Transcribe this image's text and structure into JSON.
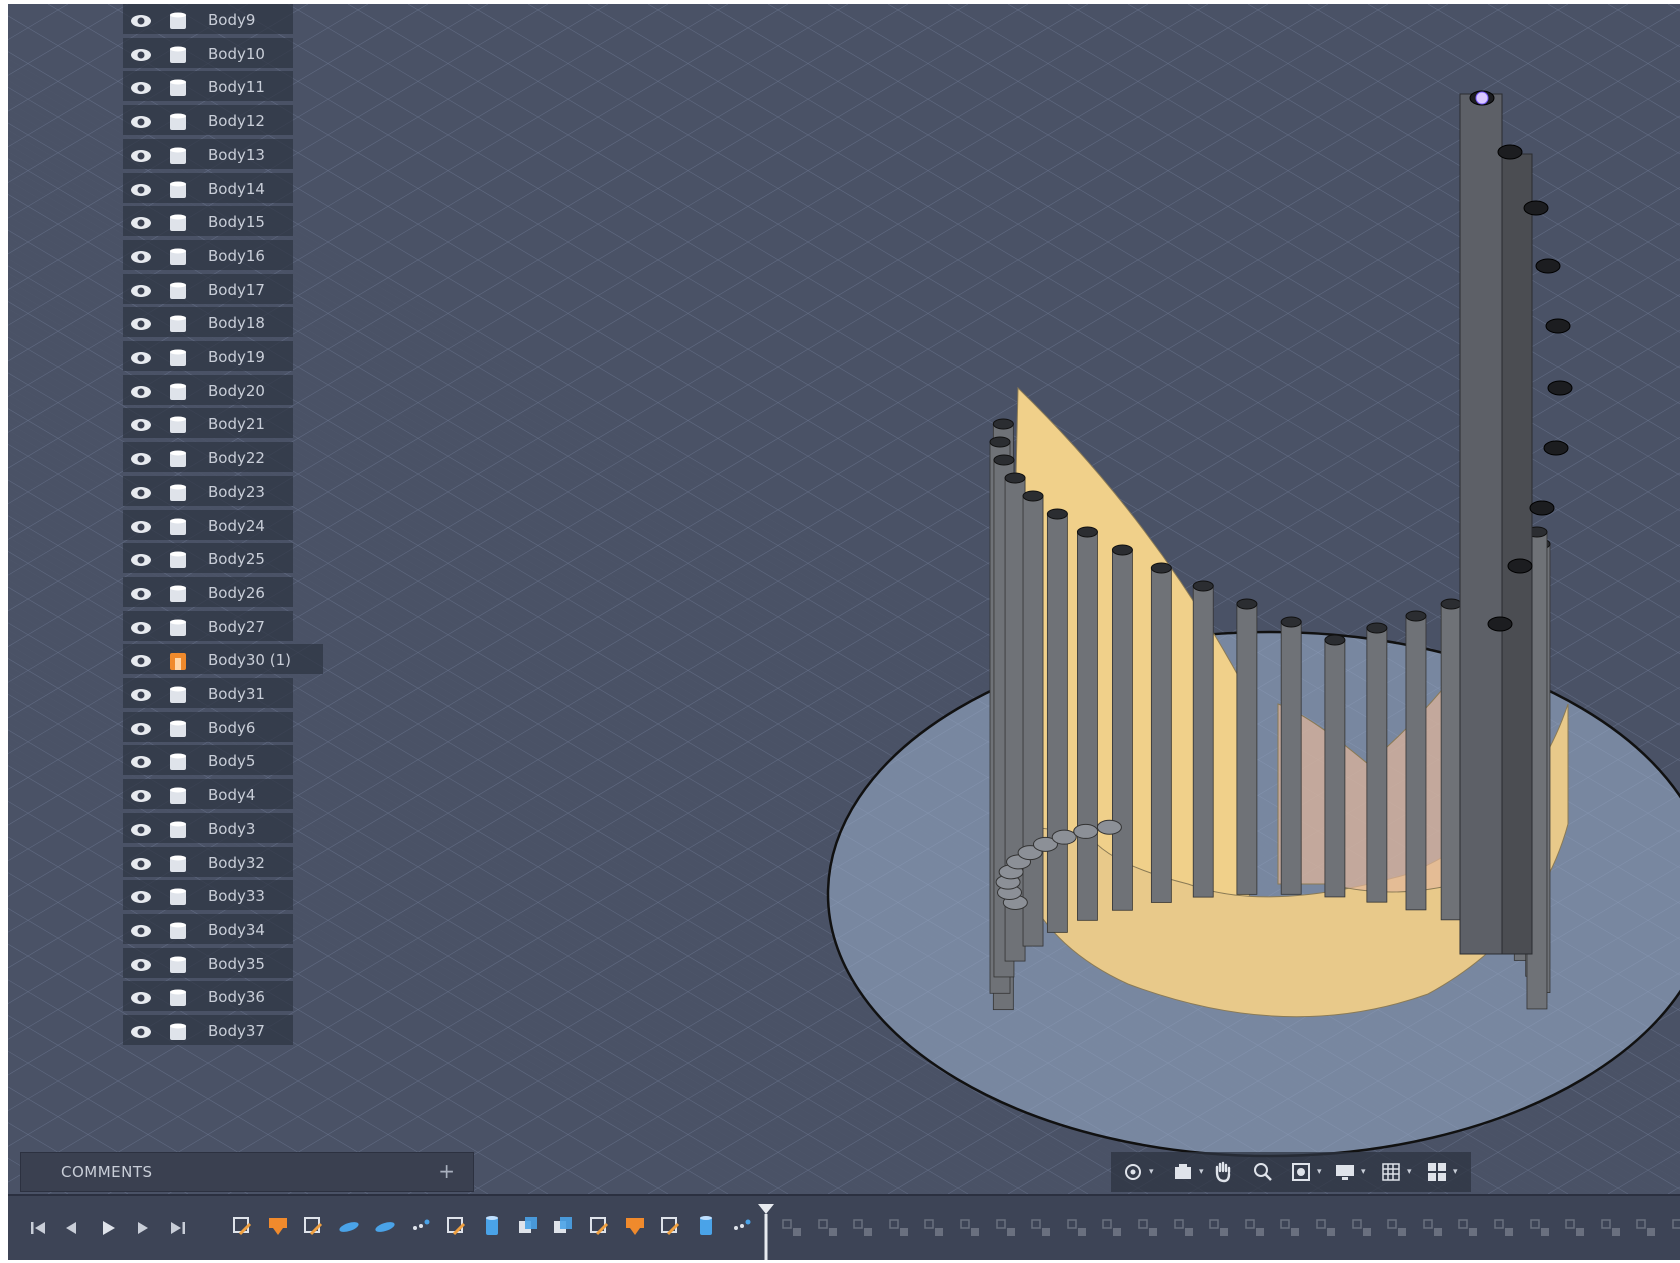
{
  "browser": {
    "bodies": [
      {
        "label": "Body9",
        "icon": "body-icon"
      },
      {
        "label": "Body10",
        "icon": "body-icon"
      },
      {
        "label": "Body11",
        "icon": "body-icon"
      },
      {
        "label": "Body12",
        "icon": "body-icon"
      },
      {
        "label": "Body13",
        "icon": "body-icon"
      },
      {
        "label": "Body14",
        "icon": "body-icon"
      },
      {
        "label": "Body15",
        "icon": "body-icon"
      },
      {
        "label": "Body16",
        "icon": "body-icon"
      },
      {
        "label": "Body17",
        "icon": "body-icon"
      },
      {
        "label": "Body18",
        "icon": "body-icon"
      },
      {
        "label": "Body19",
        "icon": "body-icon"
      },
      {
        "label": "Body20",
        "icon": "body-icon"
      },
      {
        "label": "Body21",
        "icon": "body-icon"
      },
      {
        "label": "Body22",
        "icon": "body-icon"
      },
      {
        "label": "Body23",
        "icon": "body-icon"
      },
      {
        "label": "Body24",
        "icon": "body-icon"
      },
      {
        "label": "Body25",
        "icon": "body-icon"
      },
      {
        "label": "Body26",
        "icon": "body-icon"
      },
      {
        "label": "Body27",
        "icon": "body-icon"
      },
      {
        "label": "Body30 (1)",
        "icon": "body-highlighted-icon"
      },
      {
        "label": "Body31",
        "icon": "body-icon"
      },
      {
        "label": "Body6",
        "icon": "body-icon"
      },
      {
        "label": "Body5",
        "icon": "body-icon"
      },
      {
        "label": "Body4",
        "icon": "body-icon"
      },
      {
        "label": "Body3",
        "icon": "body-icon"
      },
      {
        "label": "Body32",
        "icon": "body-icon"
      },
      {
        "label": "Body33",
        "icon": "body-icon"
      },
      {
        "label": "Body34",
        "icon": "body-icon"
      },
      {
        "label": "Body35",
        "icon": "body-icon"
      },
      {
        "label": "Body36",
        "icon": "body-icon"
      },
      {
        "label": "Body37",
        "icon": "body-icon"
      }
    ]
  },
  "comments": {
    "label": "COMMENTS",
    "add_icon": "plus-icon"
  },
  "nav_toolbar": {
    "items": [
      "orbit-icon",
      "look-at-icon",
      "pan-icon",
      "zoom-icon",
      "fit-icon",
      "display-settings-icon",
      "grid-icon",
      "viewports-icon"
    ]
  },
  "timeline": {
    "playback": [
      "skip-to-start-icon",
      "step-back-icon",
      "play-icon",
      "step-forward-icon",
      "skip-to-end-icon"
    ],
    "features": [
      "sketch-icon",
      "body-orange-icon",
      "sketch-icon",
      "plane-icon",
      "plane-icon",
      "point-icon",
      "sketch-icon",
      "extrude-icon",
      "combine-icon",
      "combine-icon",
      "sketch-icon",
      "body-orange-icon",
      "sketch-icon",
      "extrude-icon",
      "point-icon"
    ],
    "suppressed_count": 26
  },
  "colors": {
    "viewport_bg": "#4a5266",
    "panel_bg": "#2e3442",
    "accent_orange": "#f08a2c",
    "surface_yellow": "#f0d08a",
    "feature_blue": "#4aa3e8"
  }
}
